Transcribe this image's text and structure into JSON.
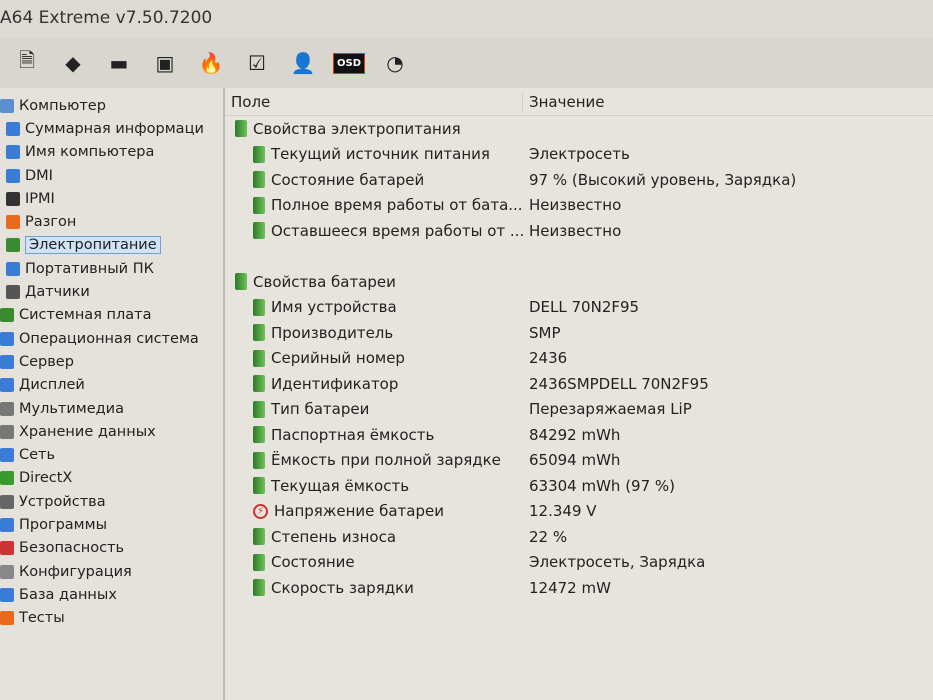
{
  "window": {
    "title": "A64 Extreme v7.50.7200"
  },
  "toolbar": [
    {
      "name": "report-icon",
      "glyph": "🗎"
    },
    {
      "name": "cpu-icon",
      "glyph": "◆"
    },
    {
      "name": "memory-icon",
      "glyph": "▬"
    },
    {
      "name": "motherboard-icon",
      "glyph": "▣"
    },
    {
      "name": "overclock-icon",
      "glyph": "🔥"
    },
    {
      "name": "config-icon",
      "glyph": "☑"
    },
    {
      "name": "user-icon",
      "glyph": "👤"
    },
    {
      "name": "osd-icon",
      "glyph": "OSD"
    },
    {
      "name": "gauge-icon",
      "glyph": "◔"
    }
  ],
  "tree": [
    {
      "label": "Компьютер",
      "indent": 0,
      "color": "#5b8fd0"
    },
    {
      "label": "Суммарная информаци",
      "indent": 1,
      "color": "#3a7bd5"
    },
    {
      "label": "Имя компьютера",
      "indent": 1,
      "color": "#3a7bd5"
    },
    {
      "label": "DMI",
      "indent": 1,
      "color": "#3a7bd5"
    },
    {
      "label": "IPMI",
      "indent": 1,
      "color": "#333"
    },
    {
      "label": "Разгон",
      "indent": 1,
      "color": "#e86a1a"
    },
    {
      "label": "Электропитание",
      "indent": 1,
      "color": "#3a8a30",
      "selected": true
    },
    {
      "label": "Портативный ПК",
      "indent": 1,
      "color": "#3a7bd5"
    },
    {
      "label": "Датчики",
      "indent": 1,
      "color": "#555"
    },
    {
      "label": "Системная плата",
      "indent": 0,
      "color": "#3a8a30"
    },
    {
      "label": "Операционная система",
      "indent": 0,
      "color": "#3a7bd5"
    },
    {
      "label": "Сервер",
      "indent": 0,
      "color": "#3a7bd5"
    },
    {
      "label": "Дисплей",
      "indent": 0,
      "color": "#3a7bd5"
    },
    {
      "label": "Мультимедиа",
      "indent": 0,
      "color": "#777"
    },
    {
      "label": "Хранение данных",
      "indent": 0,
      "color": "#777"
    },
    {
      "label": "Сеть",
      "indent": 0,
      "color": "#3a7bd5"
    },
    {
      "label": "DirectX",
      "indent": 0,
      "color": "#3a9a30"
    },
    {
      "label": "Устройства",
      "indent": 0,
      "color": "#666"
    },
    {
      "label": "Программы",
      "indent": 0,
      "color": "#3a7bd5"
    },
    {
      "label": "Безопасность",
      "indent": 0,
      "color": "#c33"
    },
    {
      "label": "Конфигурация",
      "indent": 0,
      "color": "#888"
    },
    {
      "label": "База данных",
      "indent": 0,
      "color": "#3a7bd5"
    },
    {
      "label": "Тесты",
      "indent": 0,
      "color": "#e86a1a"
    }
  ],
  "columns": {
    "field": "Поле",
    "value": "Значение"
  },
  "rows": [
    {
      "field": "Свойства электропитания",
      "value": "",
      "level": 0,
      "icon": "battery"
    },
    {
      "field": "Текущий источник питания",
      "value": "Электросеть",
      "level": 1,
      "icon": "battery"
    },
    {
      "field": "Состояние батарей",
      "value": "97 % (Высокий уровень, Зарядка)",
      "level": 1,
      "icon": "battery"
    },
    {
      "field": "Полное время работы от бата...",
      "value": "Неизвестно",
      "level": 1,
      "icon": "battery"
    },
    {
      "field": "Оставшееся время работы от ...",
      "value": "Неизвестно",
      "level": 1,
      "icon": "battery"
    },
    {
      "field": "",
      "value": "",
      "level": 0,
      "icon": "none"
    },
    {
      "field": "Свойства батареи",
      "value": "",
      "level": 0,
      "icon": "battery"
    },
    {
      "field": "Имя устройства",
      "value": "DELL 70N2F95",
      "level": 1,
      "icon": "battery"
    },
    {
      "field": "Производитель",
      "value": "SMP",
      "level": 1,
      "icon": "battery"
    },
    {
      "field": "Серийный номер",
      "value": "2436",
      "level": 1,
      "icon": "battery"
    },
    {
      "field": "Идентификатор",
      "value": "2436SMPDELL 70N2F95",
      "level": 1,
      "icon": "battery"
    },
    {
      "field": "Тип батареи",
      "value": "Перезаряжаемая LiP",
      "level": 1,
      "icon": "battery"
    },
    {
      "field": "Паспортная ёмкость",
      "value": "84292 mWh",
      "level": 1,
      "icon": "battery"
    },
    {
      "field": "Ёмкость при полной зарядке",
      "value": "65094 mWh",
      "level": 1,
      "icon": "battery"
    },
    {
      "field": "Текущая ёмкость",
      "value": "63304 mWh  (97 %)",
      "level": 1,
      "icon": "battery"
    },
    {
      "field": "Напряжение батареи",
      "value": "12.349 V",
      "level": 1,
      "icon": "voltage"
    },
    {
      "field": "Степень износа",
      "value": "22 %",
      "level": 1,
      "icon": "battery"
    },
    {
      "field": "Состояние",
      "value": "Электросеть, Зарядка",
      "level": 1,
      "icon": "battery"
    },
    {
      "field": "Скорость зарядки",
      "value": "12472 mW",
      "level": 1,
      "icon": "battery"
    }
  ]
}
